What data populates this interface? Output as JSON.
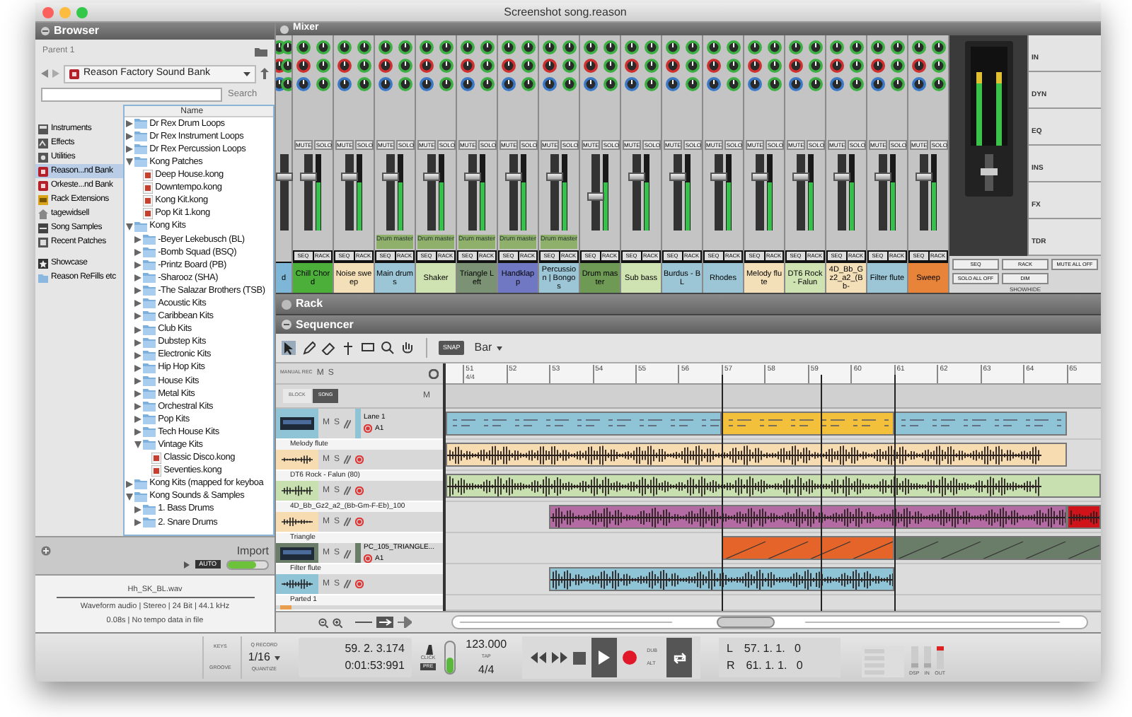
{
  "window": {
    "title": "Screenshot song.reason"
  },
  "browser": {
    "title": "Browser",
    "parent": "Parent 1",
    "location": "Reason Factory Sound Bank",
    "search_button": "Search",
    "locations": [
      {
        "label": "Instruments",
        "kind": "instruments",
        "selected": false
      },
      {
        "label": "Effects",
        "kind": "effects",
        "selected": false
      },
      {
        "label": "Utilities",
        "kind": "utilities",
        "selected": false
      },
      {
        "label": "Reason...nd Bank",
        "kind": "bank",
        "selected": true
      },
      {
        "label": "Orkeste...nd Bank",
        "kind": "bank",
        "selected": false
      },
      {
        "label": "Rack Extensions",
        "kind": "extensions",
        "selected": false
      },
      {
        "label": "tagewidsell",
        "kind": "home",
        "selected": false
      },
      {
        "label": "Song Samples",
        "kind": "samples",
        "selected": false
      },
      {
        "label": "Recent Patches",
        "kind": "recent",
        "selected": false
      },
      {
        "label": "Showcase",
        "kind": "showcase",
        "selected": false
      },
      {
        "label": "Reason ReFills etc",
        "kind": "folder",
        "selected": false
      }
    ],
    "tree_header": "Name",
    "tree": [
      {
        "label": "Dr Rex Drum Loops",
        "kind": "folder",
        "expanded": false
      },
      {
        "label": "Dr Rex Instrument Loops",
        "kind": "folder",
        "expanded": false
      },
      {
        "label": "Dr Rex Percussion Loops",
        "kind": "folder",
        "expanded": false
      },
      {
        "label": "Kong Patches",
        "kind": "folder",
        "expanded": true,
        "children": [
          {
            "label": "Deep House.kong",
            "kind": "file"
          },
          {
            "label": "Downtempo.kong",
            "kind": "file"
          },
          {
            "label": "Kong Kit.kong",
            "kind": "file"
          },
          {
            "label": "Pop Kit 1.kong",
            "kind": "file"
          }
        ]
      },
      {
        "label": "Kong Kits",
        "kind": "folder",
        "expanded": true,
        "children": [
          {
            "label": "-Beyer Lekebusch (BL)",
            "kind": "folder",
            "expanded": false
          },
          {
            "label": "-Bomb Squad (BSQ)",
            "kind": "folder",
            "expanded": false
          },
          {
            "label": "-Printz Board (PB)",
            "kind": "folder",
            "expanded": false
          },
          {
            "label": "-Sharooz (SHA)",
            "kind": "folder",
            "expanded": false
          },
          {
            "label": "-The Salazar Brothers (TSB)",
            "kind": "folder",
            "expanded": false
          },
          {
            "label": "Acoustic Kits",
            "kind": "folder",
            "expanded": false
          },
          {
            "label": "Caribbean Kits",
            "kind": "folder",
            "expanded": false
          },
          {
            "label": "Club Kits",
            "kind": "folder",
            "expanded": false
          },
          {
            "label": "Dubstep Kits",
            "kind": "folder",
            "expanded": false
          },
          {
            "label": "Electronic Kits",
            "kind": "folder",
            "expanded": false
          },
          {
            "label": "Hip Hop Kits",
            "kind": "folder",
            "expanded": false
          },
          {
            "label": "House Kits",
            "kind": "folder",
            "expanded": false
          },
          {
            "label": "Metal Kits",
            "kind": "folder",
            "expanded": false
          },
          {
            "label": "Orchestral Kits",
            "kind": "folder",
            "expanded": false
          },
          {
            "label": "Pop Kits",
            "kind": "folder",
            "expanded": false
          },
          {
            "label": "Tech House Kits",
            "kind": "folder",
            "expanded": false
          },
          {
            "label": "Vintage Kits",
            "kind": "folder",
            "expanded": true,
            "children": [
              {
                "label": "Classic Disco.kong",
                "kind": "file"
              },
              {
                "label": "Seventies.kong",
                "kind": "file"
              }
            ]
          }
        ]
      },
      {
        "label": "Kong Kits (mapped for keyboa",
        "kind": "folder",
        "expanded": false
      },
      {
        "label": "Kong Sounds & Samples",
        "kind": "folder",
        "expanded": true,
        "children": [
          {
            "label": "1. Bass Drums",
            "kind": "folder",
            "expanded": false
          },
          {
            "label": "2. Snare Drums",
            "kind": "folder",
            "expanded": false
          }
        ]
      }
    ],
    "import": {
      "label": "Import",
      "auto": "AUTO",
      "auto_on": true
    },
    "file_info": {
      "name": "Hh_SK_BL.wav",
      "format": "Waveform audio | Stereo | 24 Bit | 44.1 kHz",
      "tempo": "0.08s | No tempo data in file"
    }
  },
  "mixer": {
    "title": "Mixer",
    "channels": [
      {
        "name": "d",
        "color": "#7db6d6",
        "level": 0.7
      },
      {
        "name": "Chill Chord",
        "color": "#4caf3a",
        "level": 0.7,
        "mute": "MUTE",
        "solo": "SOLO",
        "seq": "SEQ",
        "rack": "RACK"
      },
      {
        "name": "Noise sweep",
        "color": "#f3dfb8",
        "level": 0.7,
        "mute": "MUTE",
        "solo": "SOLO",
        "seq": "SEQ",
        "rack": "RACK"
      },
      {
        "name": "Main drums",
        "color": "#9cc6d6",
        "level": 0.7,
        "output": "Drum master",
        "mute": "MUTE",
        "solo": "SOLO",
        "seq": "SEQ",
        "rack": "RACK"
      },
      {
        "name": "Shaker",
        "color": "#cfe3b2",
        "level": 0.7,
        "output": "Drum master",
        "mute": "MUTE",
        "solo": "SOLO",
        "seq": "SEQ",
        "rack": "RACK"
      },
      {
        "name": "Triangle Left",
        "color": "#7b9274",
        "level": 0.7,
        "output": "Drum master",
        "mute": "MUTE",
        "solo": "SOLO",
        "seq": "SEQ",
        "rack": "RACK"
      },
      {
        "name": "Handklapp",
        "color": "#7078c4",
        "level": 0.7,
        "output": "Drum master",
        "mute": "MUTE",
        "solo": "SOLO",
        "seq": "SEQ",
        "rack": "RACK"
      },
      {
        "name": "Percussion | Bongos",
        "color": "#9cc6d6",
        "level": 0.7,
        "output": "Drum master",
        "mute": "MUTE",
        "solo": "SOLO",
        "seq": "SEQ",
        "rack": "RACK"
      },
      {
        "name": "Drum master",
        "color": "#6f9a55",
        "level": 0.45,
        "mute": "MUTE",
        "solo": "SOLO",
        "seq": "SEQ",
        "rack": "RACK"
      },
      {
        "name": "Sub bass",
        "color": "#cfe3b2",
        "level": 0.7,
        "mute": "MUTE",
        "solo": "SOLO",
        "seq": "SEQ",
        "rack": "RACK"
      },
      {
        "name": "Burdus - BL",
        "color": "#9cc6d6",
        "level": 0.7,
        "mute": "MUTE",
        "solo": "SOLO",
        "seq": "SEQ",
        "rack": "RACK"
      },
      {
        "name": "Rhodes",
        "color": "#9cc6d6",
        "level": 0.7,
        "mute": "MUTE",
        "solo": "SOLO",
        "seq": "SEQ",
        "rack": "RACK"
      },
      {
        "name": "Melody flute",
        "color": "#f3dfb8",
        "level": 0.7,
        "mute": "MUTE",
        "solo": "SOLO",
        "seq": "SEQ",
        "rack": "RACK"
      },
      {
        "name": "DT6 Rock - Falun",
        "color": "#cfe3b2",
        "level": 0.7,
        "mute": "MUTE",
        "solo": "SOLO",
        "seq": "SEQ",
        "rack": "RACK"
      },
      {
        "name": "4D_Bb_Gz2_a2_(Bb-",
        "color": "#f3dfb8",
        "level": 0.7,
        "mute": "MUTE",
        "solo": "SOLO",
        "seq": "SEQ",
        "rack": "RACK"
      },
      {
        "name": "Filter flute",
        "color": "#9cc6d6",
        "level": 0.7,
        "mute": "MUTE",
        "solo": "SOLO",
        "seq": "SEQ",
        "rack": "RACK"
      },
      {
        "name": "Sweep",
        "color": "#e8843a",
        "level": 0.7,
        "mute": "MUTE",
        "solo": "SOLO",
        "seq": "SEQ",
        "rack": "RACK"
      }
    ],
    "sections": [
      "IN",
      "DYN",
      "EQ",
      "INS",
      "FX",
      "TDR"
    ],
    "master_buttons": [
      "SEQ",
      "RACK",
      "MUTE ALL OFF",
      "SOLO ALL OFF",
      "DIM"
    ],
    "showhide": "SHOWHIDE"
  },
  "rack": {
    "title": "Rack"
  },
  "sequencer": {
    "title": "Sequencer",
    "snap": "SNAP",
    "snap_value": "Bar",
    "manual_rec": "MANUAL REC",
    "mute_all": "M",
    "solo_all": "S",
    "block": "BLOCK",
    "song": "SONG",
    "song_mode": true,
    "block_mute": "M",
    "ruler": [
      "51",
      "52",
      "53",
      "54",
      "55",
      "56",
      "57",
      "58",
      "59",
      "60",
      "61",
      "62",
      "63",
      "64",
      "65"
    ],
    "time_signature": "4/4",
    "tracks": [
      {
        "kind": "instrument",
        "lane": "Lane 1",
        "input": "A1",
        "mute": "M",
        "solo": "S",
        "color": "#8fc3d6",
        "clips": [
          {
            "kind": "notes",
            "color": "#8fc3d6"
          },
          {
            "kind": "notes",
            "color": "#f2c03a"
          },
          {
            "kind": "notes",
            "color": "#8fc3d6"
          }
        ]
      },
      {
        "kind": "audio",
        "header": "Melody flute",
        "mute": "M",
        "solo": "S",
        "color": "#f6dcb0",
        "clips": [
          {
            "kind": "wave",
            "color": "#f6dcb0"
          }
        ]
      },
      {
        "kind": "audio",
        "header": "DT6 Rock - Falun  (80)",
        "mute": "M",
        "solo": "S",
        "color": "#c8e0b0",
        "clips": [
          {
            "kind": "wave",
            "color": "#c8e0b0"
          }
        ]
      },
      {
        "kind": "audio",
        "header": "4D_Bb_Gz2_a2_(Bb-Gm-F-Eb)_100",
        "mute": "M",
        "solo": "S",
        "color": "#f6dcb0",
        "clips": [
          {
            "kind": "wave",
            "color": "#b46aa3"
          },
          {
            "kind": "wave",
            "color": "#d0121a"
          }
        ]
      },
      {
        "kind": "instrument",
        "header": "Triangle",
        "lane": "PC_105_TRIANGLE...",
        "input": "A1",
        "mute": "M",
        "solo": "S",
        "color": "#6a7d68",
        "clips": [
          {
            "kind": "ramp",
            "color": "#e4642a"
          },
          {
            "kind": "ramp",
            "color": "#6a7d68"
          }
        ]
      },
      {
        "kind": "audio",
        "header": "Filter flute",
        "mute": "M",
        "solo": "S",
        "color": "#8fc3d6",
        "clips": [
          {
            "kind": "wave",
            "color": "#8fc3d6"
          }
        ]
      },
      {
        "kind": "partial",
        "header": "Parted 1",
        "color": "#e8a050"
      }
    ]
  },
  "transport": {
    "keys": "KEYS",
    "groove": "GROOVE",
    "q_record": "Q RECORD",
    "quantize_value": "1/16",
    "quantize": "QUANTIZE",
    "position": "59. 2. 3.174",
    "time": "0:01:53:991",
    "click": "CLICK",
    "pre": "PRE",
    "tempo": "123.000",
    "tap": "TAP",
    "signature": "4/4",
    "dub": "DUB",
    "alt": "ALT",
    "loop_on": true,
    "playing": true,
    "left_label": "L",
    "left": "57. 1. 1.   0",
    "right_label": "R",
    "right": "61. 1. 1.   0",
    "dsp": "DSP",
    "in": "IN",
    "out": "OUT"
  }
}
